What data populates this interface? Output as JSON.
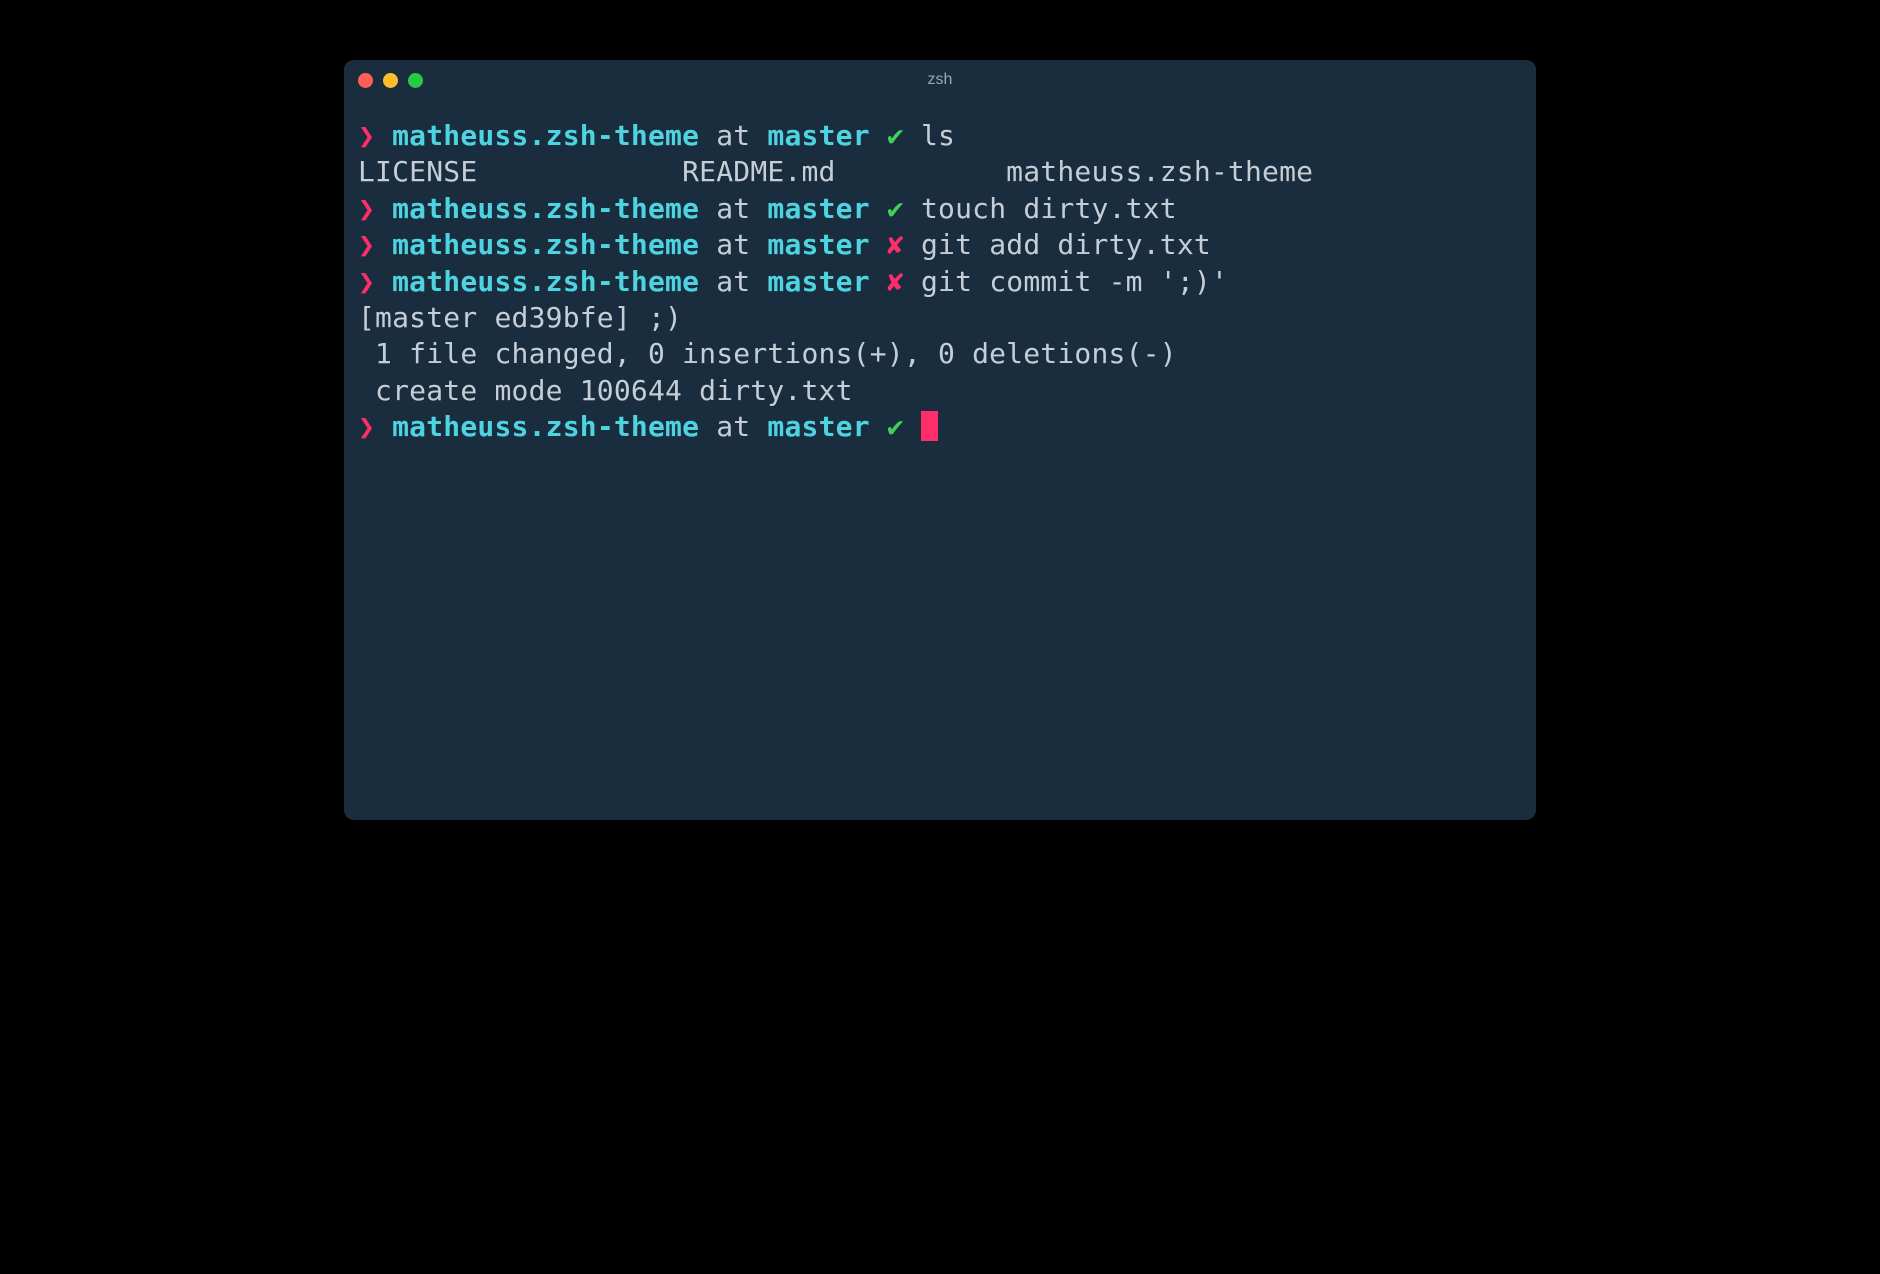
{
  "window": {
    "title": "zsh"
  },
  "prompt": {
    "arrow": "❯",
    "dir": "matheuss.zsh-theme",
    "at": "at",
    "branch": "master",
    "clean": "✔",
    "dirty": "✘"
  },
  "lines": [
    {
      "type": "prompt",
      "status": "clean",
      "cmd": "ls"
    },
    {
      "type": "output",
      "text": "LICENSE            README.md          matheuss.zsh-theme"
    },
    {
      "type": "prompt",
      "status": "clean",
      "cmd": "touch dirty.txt"
    },
    {
      "type": "prompt",
      "status": "dirty",
      "cmd": "git add dirty.txt"
    },
    {
      "type": "prompt",
      "status": "dirty",
      "cmd": "git commit -m ';)'"
    },
    {
      "type": "output",
      "text": "[master ed39bfe] ;)"
    },
    {
      "type": "output",
      "text": " 1 file changed, 0 insertions(+), 0 deletions(-)"
    },
    {
      "type": "output",
      "text": " create mode 100644 dirty.txt"
    },
    {
      "type": "prompt",
      "status": "clean",
      "cmd": "",
      "cursor": true
    }
  ]
}
